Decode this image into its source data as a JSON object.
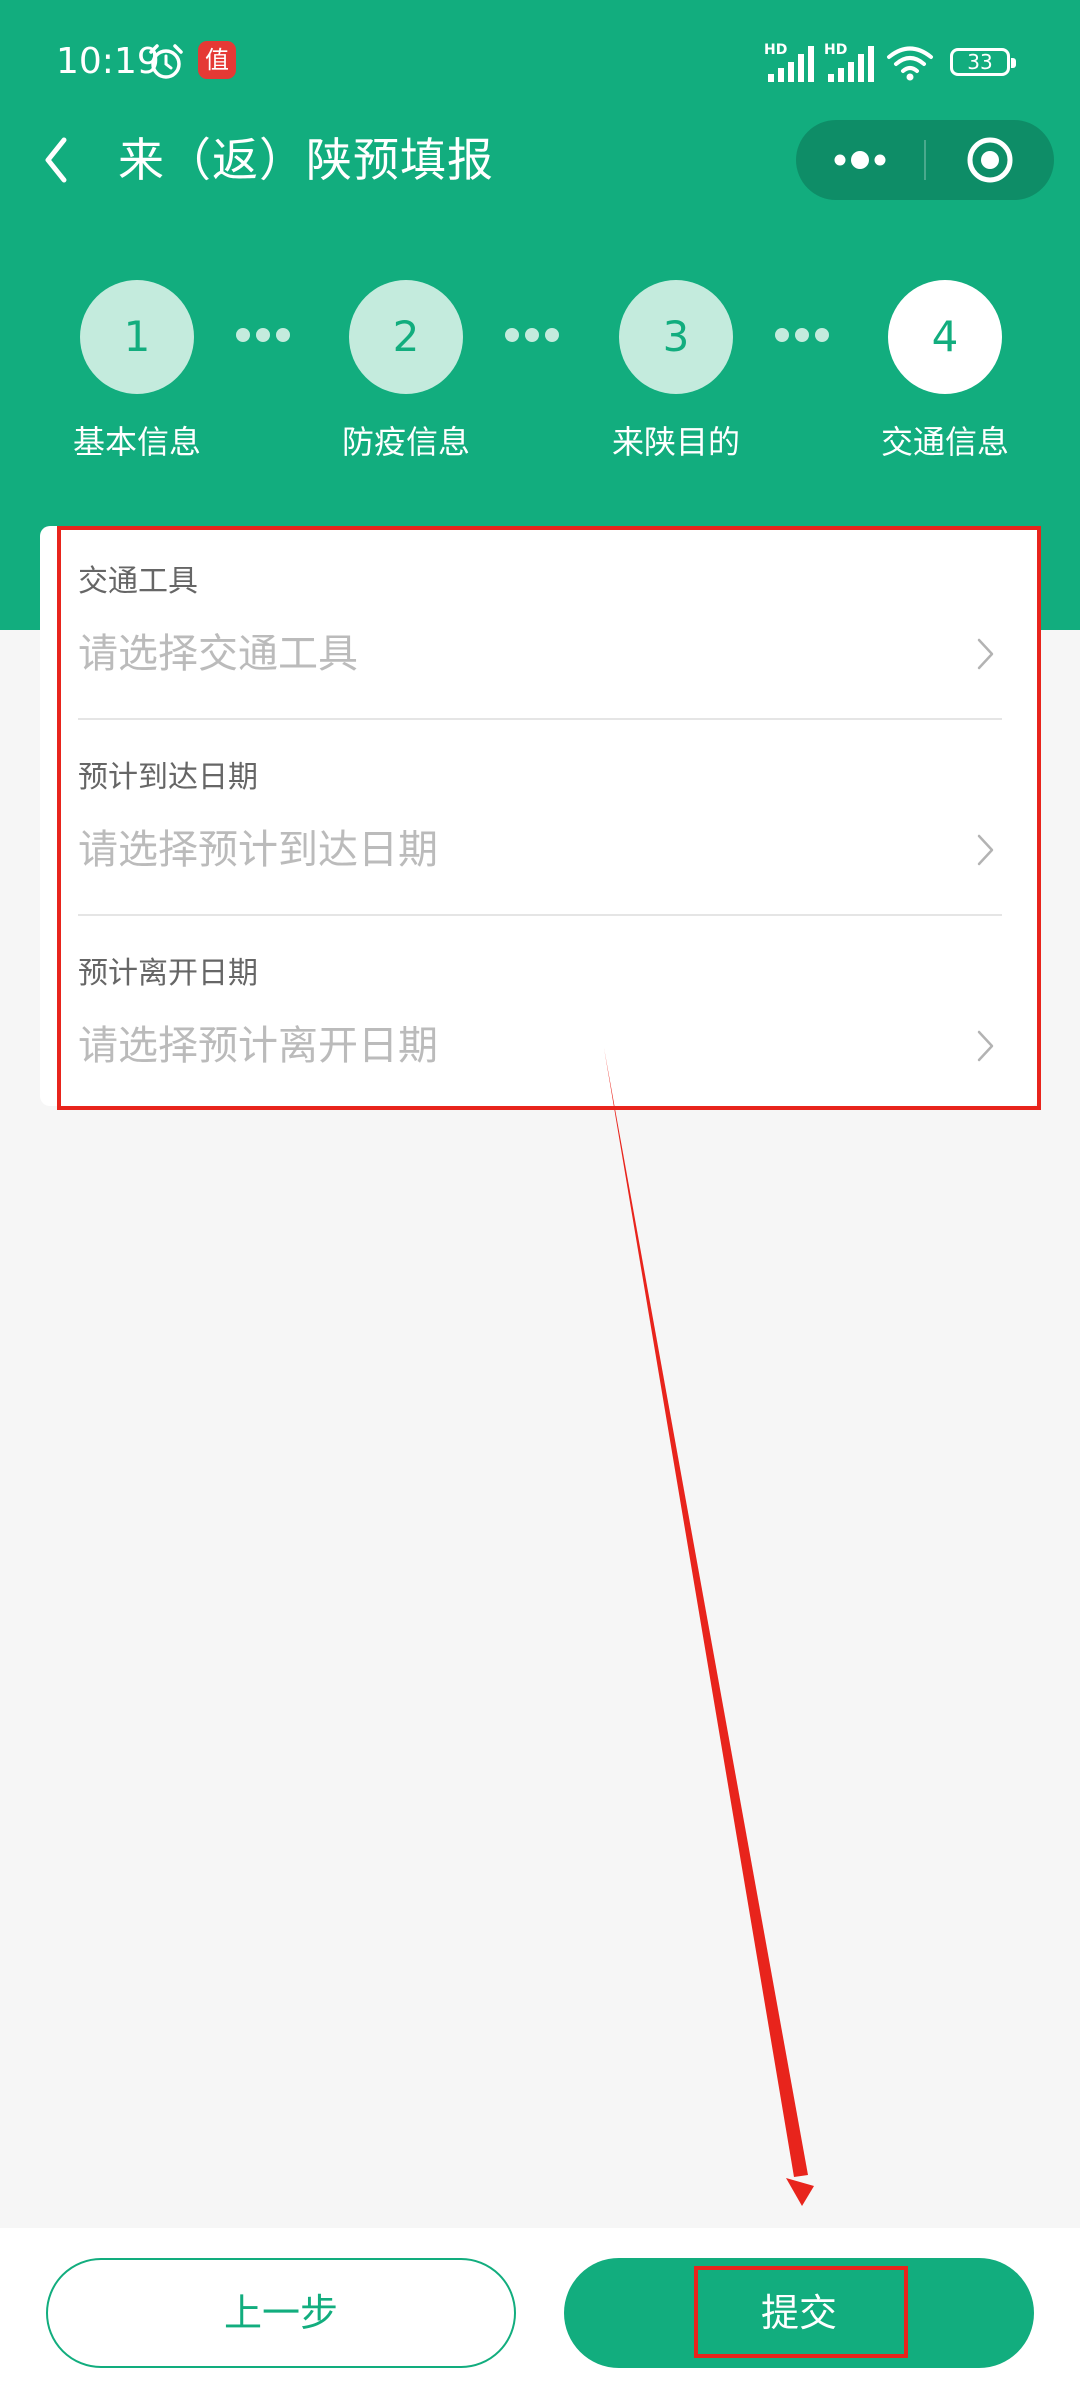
{
  "status_bar": {
    "time": "10:19",
    "app_badge": "值",
    "battery": "33",
    "network_label": "HD"
  },
  "title_bar": {
    "title": "来（返）陕预填报"
  },
  "steps": [
    {
      "number": "1",
      "label": "基本信息"
    },
    {
      "number": "2",
      "label": "防疫信息"
    },
    {
      "number": "3",
      "label": "来陕目的"
    },
    {
      "number": "4",
      "label": "交通信息"
    }
  ],
  "form": {
    "fields": [
      {
        "label": "交通工具",
        "placeholder": "请选择交通工具"
      },
      {
        "label": "预计到达日期",
        "placeholder": "请选择预计到达日期"
      },
      {
        "label": "预计离开日期",
        "placeholder": "请选择预计离开日期"
      }
    ]
  },
  "actions": {
    "prev_label": "上一步",
    "submit_label": "提交"
  },
  "colors": {
    "primary": "#12ad7e",
    "annotation": "#e8241c"
  }
}
